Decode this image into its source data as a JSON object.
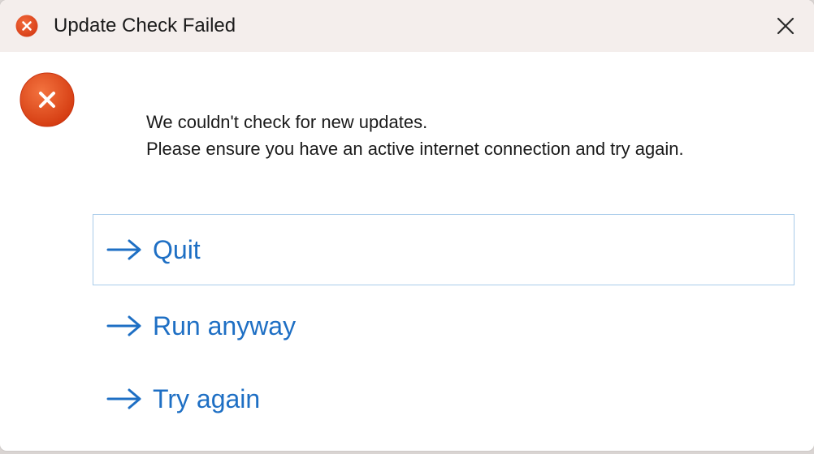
{
  "window": {
    "title": "Update Check Failed",
    "title_icon": "error-icon",
    "close_icon": "close-icon"
  },
  "message": {
    "icon": "error-icon",
    "line1": "We couldn't check for new updates.",
    "line2": "Please ensure you have an active internet connection and try again."
  },
  "commands": [
    {
      "label": "Quit",
      "icon": "arrow-right-icon",
      "focused": true
    },
    {
      "label": "Run anyway",
      "icon": "arrow-right-icon",
      "focused": false
    },
    {
      "label": "Try again",
      "icon": "arrow-right-icon",
      "focused": false
    }
  ],
  "colors": {
    "error_red": "#e0431a",
    "link_blue": "#1e6fc4",
    "focus_border": "#a9ccea",
    "titlebar_bg": "#f4eeec"
  }
}
